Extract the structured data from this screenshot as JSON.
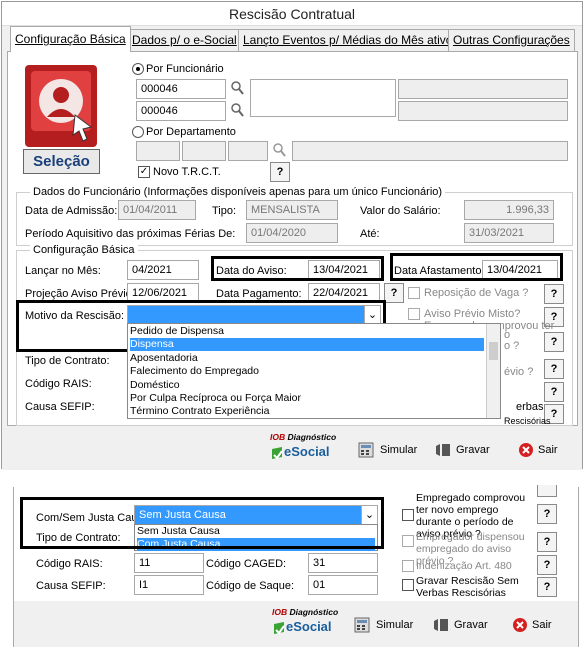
{
  "window": {
    "title": "Rescisão Contratual",
    "tabs": [
      {
        "label": "Configuração Básica"
      },
      {
        "label": "Dados p/ o e-Social"
      },
      {
        "label": "Lançto Eventos p/ Médias do Mês ativo"
      },
      {
        "label": "Outras Configurações"
      }
    ]
  },
  "selecao": {
    "button_label": "Seleção"
  },
  "filtro": {
    "por_funcionario": "Por Funcionário",
    "funcionario_de": "000046",
    "funcionario_ate": "000046",
    "por_departamento": "Por Departamento",
    "novo_trct": "Novo T.R.C.T.",
    "help": "?"
  },
  "dados_funcionario": {
    "title": "Dados do Funcionário (Informações disponíveis apenas para um único Funcionário)",
    "data_admissao_label": "Data de Admissão:",
    "data_admissao": "01/04/2011",
    "tipo_label": "Tipo:",
    "tipo": "MENSALISTA",
    "valor_salario_label": "Valor do Salário:",
    "valor_salario": "1.996,33",
    "periodo_label": "Período Aquisitivo das próximas Férias De:",
    "periodo_de": "01/04/2020",
    "ate_label": "Até:",
    "periodo_ate": "31/03/2021"
  },
  "config_basica": {
    "title": "Configuração Básica",
    "lancar_label": "Lançar no Mês:",
    "lancar": "04/2021",
    "data_aviso_label": "Data do Aviso:",
    "data_aviso": "13/04/2021",
    "data_afastamento_label": "Data Afastamento:",
    "data_afastamento": "13/04/2021",
    "projecao_label": "Projeção Aviso Prévio:",
    "projecao": "12/06/2021",
    "data_pagamento_label": "Data Pagamento:",
    "data_pagamento": "22/04/2021",
    "reposicao_label": "Reposição de Vaga ?",
    "aviso_misto_label": "Aviso Prévio Misto?",
    "empregado_comprovou_cut": "Empregado comprovou ter",
    "motivo_label": "Motivo da Rescisão:",
    "tipo_contrato_label": "Tipo de Contrato:",
    "codigo_rais_label": "Código RAIS:",
    "causa_sefip_label": "Causa SEFIP:",
    "frag_o": "o",
    "frag_o2": "o ?",
    "frag_previo": "évio ?",
    "frag_verbas": "erbas",
    "frag_rescisorias": "Rescisórias",
    "motivo_options": [
      "Pedido de Dispensa",
      "Dispensa",
      "Aposentadoria",
      "Falecimento do Empregado",
      "Doméstico",
      "Por Culpa Recíproca ou Força Maior",
      "Término Contrato Experiência"
    ],
    "motivo_selected_index": 1
  },
  "footer": {
    "iob": "IOB",
    "diagnostico": "Diagnóstico",
    "esocial": "eSocial",
    "simular": "Simular",
    "gravar": "Gravar",
    "sair": "Sair"
  },
  "bottom": {
    "justa_causa_label": "Com/Sem Justa Causa:",
    "justa_causa_value": "Sem Justa Causa",
    "tipo_contrato_label": "Tipo de Contrato:",
    "justa_causa_options": [
      "Sem Justa Causa",
      "Com Justa Causa"
    ],
    "codigo_rais_label": "Código RAIS:",
    "codigo_rais": "11",
    "codigo_caged_label": "Código CAGED:",
    "codigo_caged": "31",
    "causa_sefip_label": "Causa SEFIP:",
    "causa_sefip": "I1",
    "codigo_saque_label": "Código de Saque:",
    "codigo_saque": "01",
    "empregado_comprovou": "Empregado comprovou ter novo emprego durante o período de aviso prévio ?",
    "empregador_dispensou": "Empregador dispensou empregado do aviso prévio ?",
    "indenizacao": "Indenização Art. 480",
    "gravar_rescisao": "Gravar Rescisão Sem Verbas Rescisórias"
  }
}
